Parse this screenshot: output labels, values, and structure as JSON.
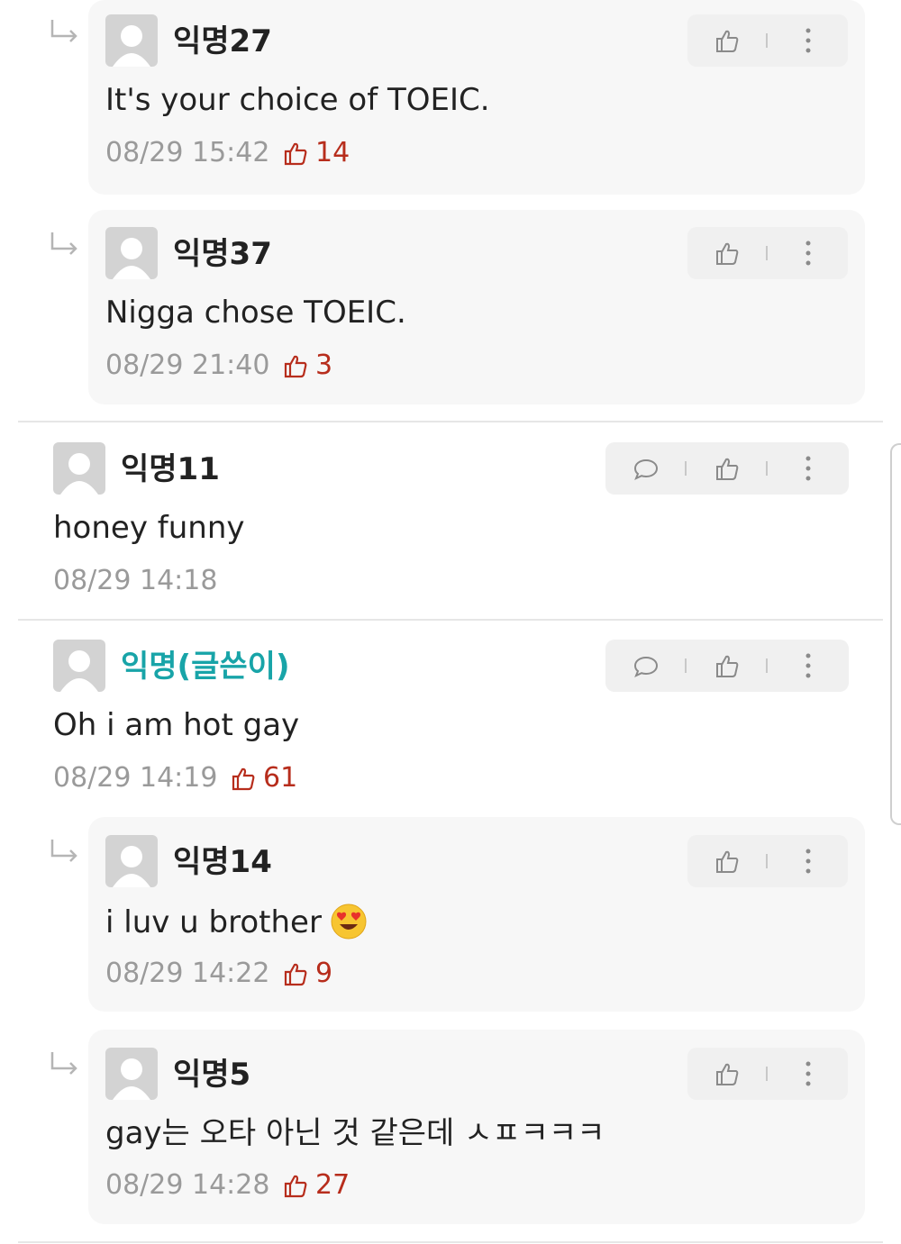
{
  "colors": {
    "like_red": "#b72d1c",
    "op_teal": "#18a4a8",
    "meta_gray": "#9a9a9a",
    "card_bg": "#f7f7f7"
  },
  "icons": {
    "reply_indicator": "reply-arrow-icon",
    "avatar": "avatar-placeholder-icon",
    "comment": "speech-bubble-icon",
    "like": "thumbs-up-icon",
    "more": "vertical-dots-icon"
  },
  "comments": [
    {
      "type": "reply",
      "nickname": "익명27",
      "text": "It's your choice of TOEIC.",
      "time": "08/29 15:42",
      "likes": "14"
    },
    {
      "type": "reply",
      "nickname": "익명37",
      "text": "Nigga chose TOEIC.",
      "time": "08/29 21:40",
      "likes": "3"
    },
    {
      "type": "comment",
      "nickname": "익명11",
      "text": "honey funny",
      "time": "08/29 14:18",
      "likes": ""
    },
    {
      "type": "comment",
      "nickname": "익명(글쓴이)",
      "is_op": true,
      "text": "Oh i am hot gay",
      "time": "08/29 14:19",
      "likes": "61"
    },
    {
      "type": "reply",
      "nickname": "익명14",
      "text": "i luv u brother",
      "emoji": "heart-eyes-emoji",
      "time": "08/29 14:22",
      "likes": "9"
    },
    {
      "type": "reply",
      "nickname": "익명5",
      "text": "gay는 오타 아닌 것 같은데 ㅅㅍㅋㅋㅋ",
      "time": "08/29 14:28",
      "likes": "27"
    }
  ]
}
